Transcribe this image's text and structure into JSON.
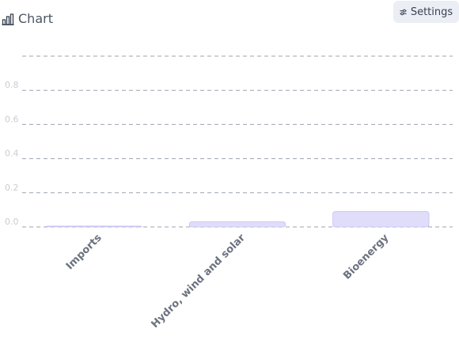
{
  "header": {
    "title": "Chart",
    "title_icon": "bar-chart-icon",
    "settings_label": "Settings",
    "settings_icon": "sliders-icon"
  },
  "colors": {
    "bar_fill": "#e0ddfb",
    "bar_stroke": "#b4b0f0",
    "grid": "#9ca3af",
    "tick_text": "#c9ccd3",
    "category_text": "#6b7280"
  },
  "chart_data": {
    "type": "bar",
    "categories": [
      "Imports",
      "Hydro, wind and solar",
      "Bioenergy"
    ],
    "values": [
      0.005,
      0.03,
      0.09
    ],
    "y_ticks": [
      "0.0",
      "0.2",
      "0.4",
      "0.6",
      "0.8"
    ],
    "ylim": [
      0,
      1.0
    ],
    "title": "",
    "xlabel": "",
    "ylabel": "",
    "grid": true,
    "legend": "none"
  }
}
